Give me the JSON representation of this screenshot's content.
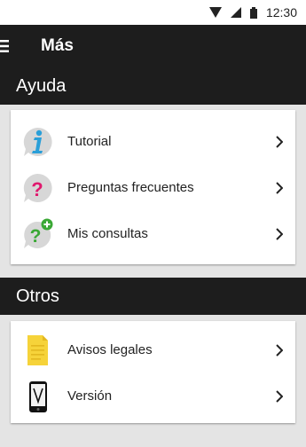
{
  "status_bar": {
    "time": "12:30"
  },
  "app_bar": {
    "title": "Más"
  },
  "sections": [
    {
      "title": "Ayuda",
      "items": [
        {
          "label": "Tutorial",
          "icon": "info-icon"
        },
        {
          "label": "Preguntas frecuentes",
          "icon": "question-icon"
        },
        {
          "label": "Mis consultas",
          "icon": "question-add-icon"
        }
      ]
    },
    {
      "title": "Otros",
      "items": [
        {
          "label": "Avisos legales",
          "icon": "document-icon"
        },
        {
          "label": "Versión",
          "icon": "phone-version-icon"
        }
      ]
    }
  ],
  "colors": {
    "bar": "#1d1d1d",
    "background": "#e4e4e4",
    "info_blue": "#2a9fd8",
    "question_pink": "#e0186d",
    "question_green": "#3aa835",
    "document_yellow": "#f6d33a"
  }
}
